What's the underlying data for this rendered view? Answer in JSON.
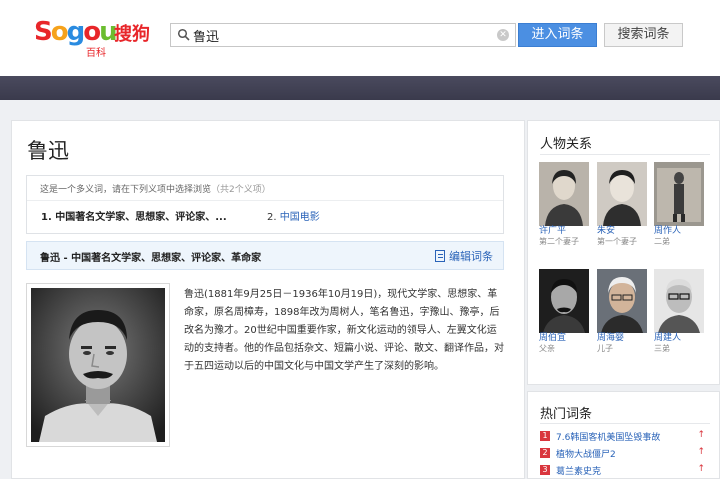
{
  "header": {
    "logo_letters": [
      "S",
      "o",
      "g",
      "o",
      "u"
    ],
    "logo_cn": "搜狗",
    "logo_sub": "百科",
    "search_value": "鲁迅",
    "enter_button": "进入词条",
    "search_button": "搜索词条"
  },
  "article": {
    "title": "鲁迅",
    "disambiguation": {
      "note": "这是一个多义词，请在下列义项中选择浏览",
      "count": "（共2个义项）",
      "options": [
        {
          "index": "1.",
          "label": "中国著名文学家、思想家、评论家、..."
        },
        {
          "index": "2.",
          "label": "中国电影"
        }
      ]
    },
    "sense_title": "鲁迅 - 中国著名文学家、思想家、评论家、革命家",
    "edit_label": "编辑词条",
    "description": "鲁迅(1881年9月25日－1936年10月19日)，现代文学家、思想家、革命家，原名周樟寿，1898年改为周树人，笔名鲁迅，字豫山、豫亭，后改名为豫才。20世纪中国重要作家，新文化运动的领导人、左翼文化运动的支持者。他的作品包括杂文、短篇小说、评论、散文、翻译作品，对于五四运动以后的中国文化与中国文学产生了深刻的影响。"
  },
  "relations": {
    "title": "人物关系",
    "people": [
      {
        "name": "许广平",
        "role": "第二个妻子"
      },
      {
        "name": "朱安",
        "role": "第一个妻子"
      },
      {
        "name": "周作人",
        "role": "二弟"
      },
      {
        "name": "周伯宜",
        "role": "父亲"
      },
      {
        "name": "周海婴",
        "role": "儿子"
      },
      {
        "name": "周建人",
        "role": "三弟"
      }
    ]
  },
  "hot": {
    "title": "热门词条",
    "items": [
      {
        "rank": "1",
        "label": "7.6韩国客机美国坠毁事故",
        "trend": "↑"
      },
      {
        "rank": "2",
        "label": "植物大战僵尸2",
        "trend": "↑"
      },
      {
        "rank": "3",
        "label": "葛兰素史克",
        "trend": "↑"
      }
    ]
  },
  "colors": {
    "brand_red": "#e8262a",
    "link_blue": "#2a63b8",
    "button_blue": "#4b8fe2",
    "nav_dark": "#3f3f52",
    "hot_rank_red": "#d9363e"
  }
}
